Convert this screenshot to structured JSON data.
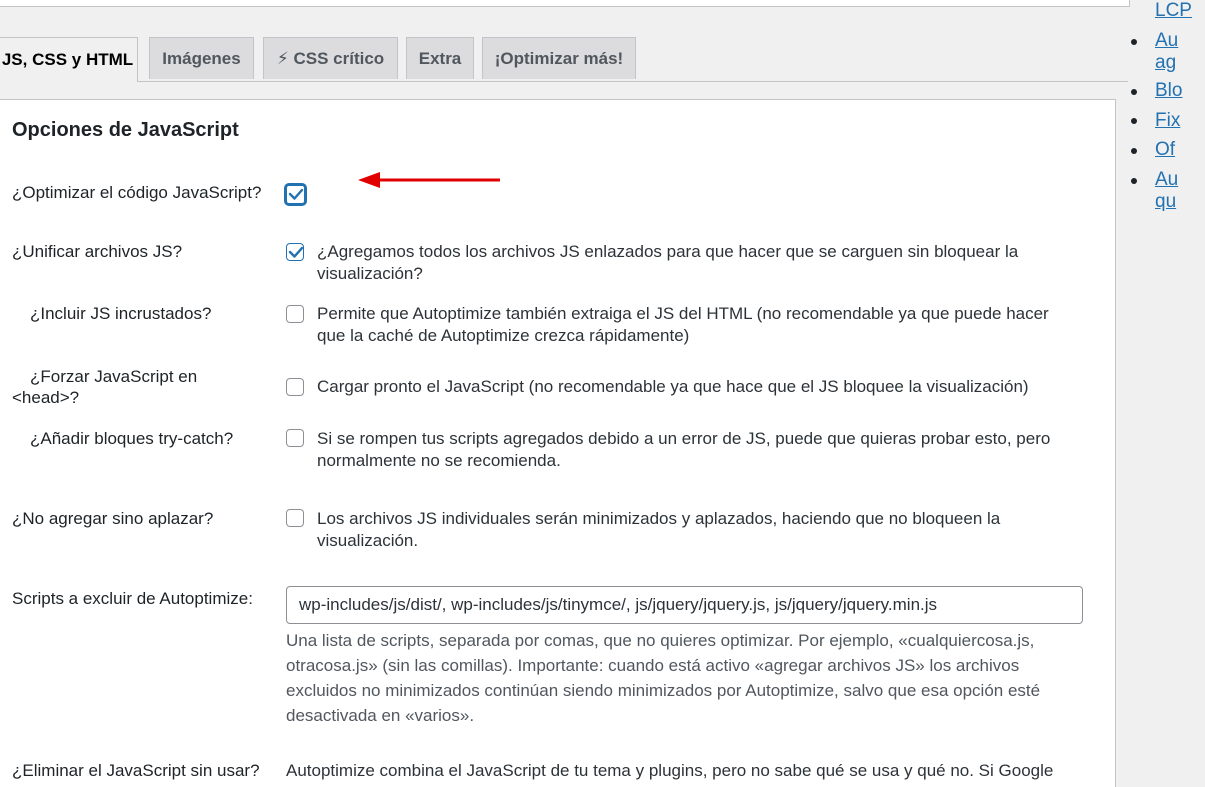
{
  "tabs": [
    {
      "label": "JS, CSS y HTML"
    },
    {
      "label": "Imágenes"
    },
    {
      "label": "⚡ CSS crítico"
    },
    {
      "label": "Extra"
    },
    {
      "label": "¡Optimizar más!"
    }
  ],
  "section": {
    "title": "Opciones de JavaScript"
  },
  "options": {
    "optimize_js": {
      "label": "¿Optimizar el código JavaScript?",
      "checked": true
    },
    "aggregate_js": {
      "label": "¿Unificar archivos JS?",
      "checked": true,
      "description_line1": "¿Agregamos todos los archivos JS enlazados para que hacer que se carguen sin bloquear la",
      "description_line2": "visualización?"
    },
    "include_inline": {
      "label": "¿Incluir JS incrustados?",
      "checked": false,
      "description_line1": "Permite que Autoptimize también extraiga el JS del HTML (no recomendable ya que puede hacer",
      "description_line2": "que la caché de Autoptimize crezca rápidamente)"
    },
    "force_head": {
      "label_line1": "¿Forzar JavaScript en",
      "label_line2": "<head>?",
      "checked": false,
      "description": "Cargar pronto el JavaScript (no recomendable ya que hace que el JS bloquee la visualización)"
    },
    "try_catch": {
      "label": "¿Añadir bloques try-catch?",
      "checked": false,
      "description_line1": "Si se rompen tus scripts agregados debido a un error de JS, puede que quieras probar esto, pero",
      "description_line2": "normalmente no se recomienda."
    },
    "defer_only": {
      "label": "¿No agregar sino aplazar?",
      "checked": false,
      "description_line1": "Los archivos JS individuales serán minimizados y aplazados, haciendo que no bloqueen la",
      "description_line2": "visualización."
    },
    "exclude": {
      "label": "Scripts a excluir de Autoptimize:",
      "value": "wp-includes/js/dist/, wp-includes/js/tinymce/, js/jquery/jquery.js, js/jquery/jquery.min.js",
      "help_line1": "Una lista de scripts, separada por comas, que no quieres optimizar. Por ejemplo, «cualquiercosa.js,",
      "help_line2": "otracosa.js» (sin las comillas). Importante: cuando está activo «agregar archivos JS» los archivos",
      "help_line3": "excluidos no minimizados continúan siendo minimizados por Autoptimize, salvo que esa opción esté",
      "help_line4": "desactivada en «varios»."
    },
    "remove_unused": {
      "label": "¿Eliminar el JavaScript sin usar?",
      "description_line1": "Autoptimize combina el JavaScript de tu tema y plugins, pero no sabe qué se usa y qué no. Si Google"
    }
  },
  "sidebar": {
    "items": [
      {
        "label": "LCP"
      },
      {
        "label": "Au"
      },
      {
        "label": "ag"
      },
      {
        "label": "Blo"
      },
      {
        "label": "Fix"
      },
      {
        "label": "Of"
      },
      {
        "label": "Au"
      },
      {
        "label": "qu"
      }
    ]
  },
  "colors": {
    "accent": "#2271b1",
    "arrow": "#e00000"
  }
}
